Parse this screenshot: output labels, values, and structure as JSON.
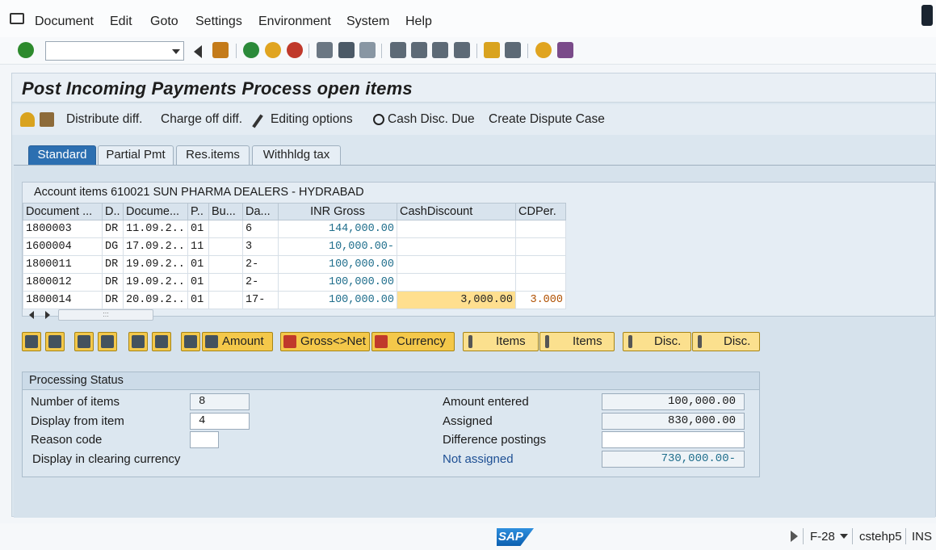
{
  "menu": [
    "Document",
    "Edit",
    "Goto",
    "Settings",
    "Environment",
    "System",
    "Help"
  ],
  "page_title": "Post Incoming Payments Process open items",
  "app_toolbar": {
    "distribute": "Distribute diff.",
    "charge_off": "Charge off diff.",
    "editing": "Editing options",
    "cash_disc": "Cash Disc. Due",
    "dispute": "Create Dispute Case"
  },
  "tabs": [
    "Standard",
    "Partial Pmt",
    "Res.items",
    "Withhldg tax"
  ],
  "table": {
    "title": "Account items 610021 SUN PHARMA DEALERS - HYDRABAD",
    "columns": [
      "Document ...",
      "D..",
      "Docume...",
      "P..",
      "Bu...",
      "Da...",
      "INR Gross",
      "CashDiscount",
      "CDPer."
    ],
    "rows": [
      [
        "1800003",
        "DR",
        "11.09.2..",
        "01",
        "",
        "6",
        "144,000.00",
        "",
        ""
      ],
      [
        "1600004",
        "DG",
        "17.09.2..",
        "11",
        "",
        "3",
        "10,000.00-",
        "",
        ""
      ],
      [
        "1800011",
        "DR",
        "19.09.2..",
        "01",
        "",
        "2-",
        "100,000.00",
        "",
        ""
      ],
      [
        "1800012",
        "DR",
        "19.09.2..",
        "01",
        "",
        "2-",
        "100,000.00",
        "",
        ""
      ],
      [
        "1800014",
        "DR",
        "20.09.2..",
        "01",
        "",
        "17-",
        "100,000.00",
        "3,000.00",
        "3.000"
      ]
    ]
  },
  "action_buttons": {
    "amount": "Amount",
    "gross_net": "Gross<>Net",
    "currency": "Currency",
    "items_1": "Items",
    "items_2": "Items",
    "disc_1": "Disc.",
    "disc_2": "Disc."
  },
  "processing": {
    "title": "Processing Status",
    "number_of_items_label": "Number of items",
    "number_of_items": "8",
    "display_from_label": "Display from item",
    "display_from": "4",
    "reason_code_label": "Reason code",
    "reason_code": "",
    "display_clearing_label": "Display in clearing currency",
    "amount_entered_label": "Amount entered",
    "amount_entered": "100,000.00",
    "assigned_label": "Assigned",
    "assigned": "830,000.00",
    "difference_label": "Difference postings",
    "difference": "",
    "not_assigned_label": "Not assigned",
    "not_assigned": "730,000.00-"
  },
  "status_bar": {
    "logo": "SAP",
    "transaction": "F-28",
    "server": "cstehp5",
    "mode": "INS"
  },
  "colors": {
    "active_tab": "#2c6fb1",
    "yellow_button": "#f4c84a",
    "highlight_cell": "#ffdf8f",
    "amount_text": "#1f6e8c"
  }
}
